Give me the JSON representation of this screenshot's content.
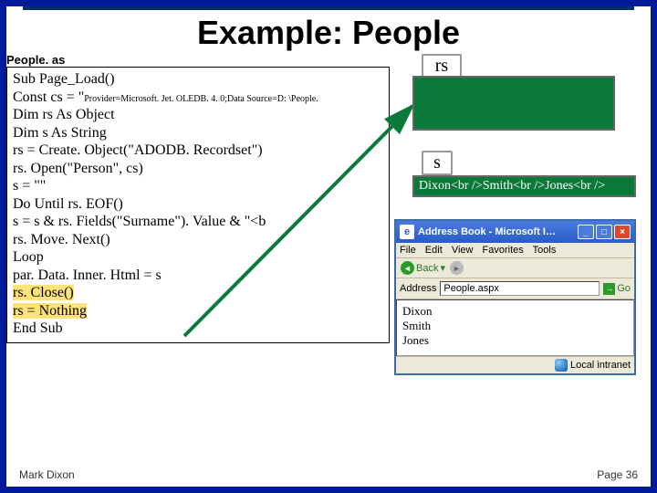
{
  "title": "Example: People",
  "filelabel": "People. as\npx",
  "code": {
    "l1": "Sub Page_Load()",
    "l2a": " Const cs = \"",
    "l2b": "Provider=Microsoft. Jet. OLEDB. 4. 0;Data Source=D: \\People.",
    "l3": " Dim rs As Object",
    "l4": " Dim s As String",
    "l5": "   rs = Create. Object(\"ADODB. Recordset\")",
    "l6": "   rs. Open(\"Person\", cs)",
    "l7": "   s = \"\"",
    "l8": "   Do Until rs. EOF()",
    "l9": "    s = s & rs. Fields(\"Surname\"). Value & \"<b",
    "l10": "    rs. Move. Next()",
    "l11": "   Loop",
    "l12": "   par. Data. Inner. Html = s",
    "l13": "   rs. Close()",
    "l14": "   rs = Nothing",
    "l15": "End Sub"
  },
  "rs_label": "rs",
  "s_label": "s",
  "s_content": "Dixon<br />Smith<br />Jones<br />",
  "browser": {
    "title": "Address Book - Microsoft I…",
    "ie_glyph": "e",
    "min": "_",
    "max": "□",
    "close": "×",
    "menu": {
      "file": "File",
      "edit": "Edit",
      "view": "View",
      "fav": "Favorites",
      "tools": "Tools"
    },
    "back": "Back",
    "back_glyph": "◄",
    "fwd_glyph": "►",
    "addr_label": "Address",
    "addr_value": "People.aspx",
    "go": "Go",
    "go_glyph": "→",
    "page": {
      "l1": "Dixon",
      "l2": "Smith",
      "l3": "Jones"
    },
    "status": "Local intranet"
  },
  "footer": {
    "left": "Mark Dixon",
    "right": "Page 36"
  }
}
